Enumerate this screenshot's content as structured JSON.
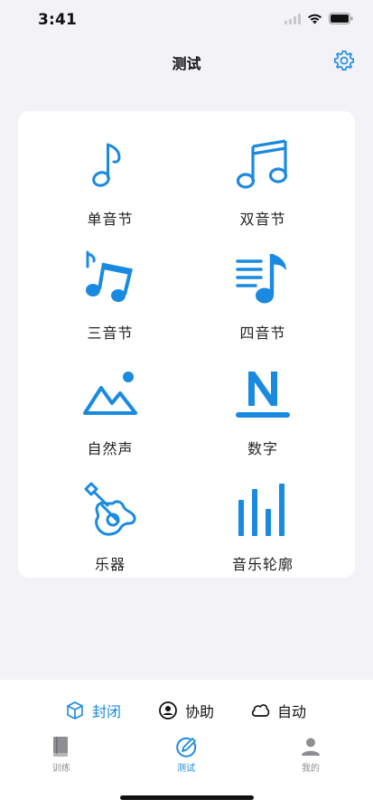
{
  "status": {
    "time": "3:41"
  },
  "header": {
    "title": "测试"
  },
  "grid": [
    {
      "label": "单音节",
      "icon": "single-note-icon"
    },
    {
      "label": "双音节",
      "icon": "double-note-icon"
    },
    {
      "label": "三音节",
      "icon": "triple-note-icon"
    },
    {
      "label": "四音节",
      "icon": "music-list-icon"
    },
    {
      "label": "自然声",
      "icon": "landscape-icon"
    },
    {
      "label": "数字",
      "icon": "letter-n-icon"
    },
    {
      "label": "乐器",
      "icon": "guitar-icon"
    },
    {
      "label": "音乐轮廓",
      "icon": "equalizer-bars-icon"
    }
  ],
  "modes": [
    {
      "label": "封闭",
      "icon": "cube-icon",
      "active": true
    },
    {
      "label": "协助",
      "icon": "person-circle-icon",
      "active": false
    },
    {
      "label": "自动",
      "icon": "cloud-icon",
      "active": false
    }
  ],
  "tabs": [
    {
      "label": "训练",
      "icon": "book-icon",
      "active": false
    },
    {
      "label": "测试",
      "icon": "pencil-circle-icon",
      "active": true
    },
    {
      "label": "我的",
      "icon": "person-icon",
      "active": false
    }
  ],
  "colors": {
    "accent": "#1a8ae0",
    "inactive": "#8e8e93",
    "background": "#f2f2f7"
  }
}
